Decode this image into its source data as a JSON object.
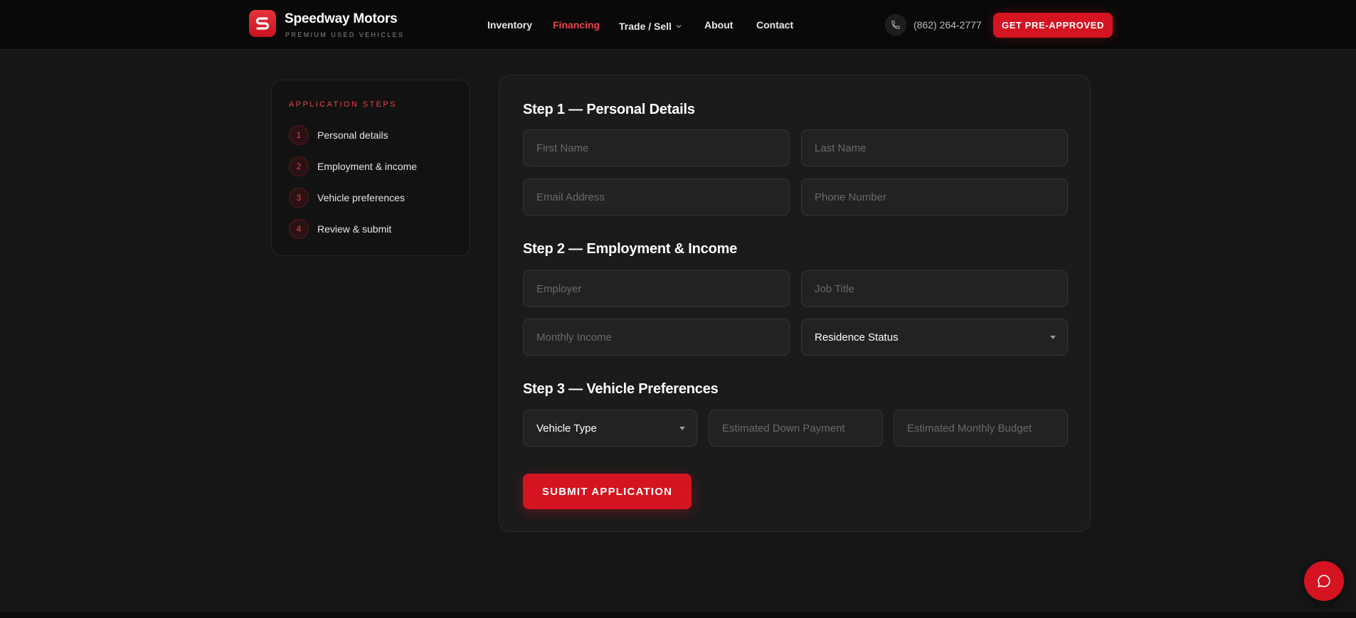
{
  "header": {
    "brand_name": "Speedway Motors",
    "brand_tagline": "PREMIUM USED VEHICLES",
    "nav": [
      {
        "label": "Inventory",
        "active": false
      },
      {
        "label": "Financing",
        "active": true
      },
      {
        "label": "Trade / Sell",
        "active": false,
        "has_dropdown": true
      },
      {
        "label": "About",
        "active": false
      },
      {
        "label": "Contact",
        "active": false
      }
    ],
    "phone": "(862) 264-2777",
    "cta_label": "GET PRE-APPROVED"
  },
  "sidebar": {
    "title": "APPLICATION STEPS",
    "steps": [
      {
        "number": "1",
        "label": "Personal details"
      },
      {
        "number": "2",
        "label": "Employment & income"
      },
      {
        "number": "3",
        "label": "Vehicle preferences"
      },
      {
        "number": "4",
        "label": "Review & submit"
      }
    ]
  },
  "form": {
    "step1": {
      "heading": "Step 1 — Personal Details",
      "first_name_placeholder": "First Name",
      "last_name_placeholder": "Last Name",
      "email_placeholder": "Email Address",
      "phone_placeholder": "Phone Number"
    },
    "step2": {
      "heading": "Step 2 — Employment & Income",
      "employer_placeholder": "Employer",
      "job_title_placeholder": "Job Title",
      "monthly_income_placeholder": "Monthly Income",
      "residence_status_value": "Residence Status"
    },
    "step3": {
      "heading": "Step 3 — Vehicle Preferences",
      "vehicle_type_value": "Vehicle Type",
      "down_payment_placeholder": "Estimated Down Payment",
      "monthly_budget_placeholder": "Estimated Monthly Budget"
    },
    "submit_label": "SUBMIT APPLICATION"
  },
  "colors": {
    "accent": "#d41420",
    "accent_text": "#e8424c",
    "background": "#161616",
    "card": "#1b1b1b",
    "field": "#222222"
  },
  "icons": {
    "logo": "s-logo-icon",
    "phone": "phone-icon",
    "chat": "chat-bubble-icon",
    "dropdown": "chevron-down-icon"
  }
}
